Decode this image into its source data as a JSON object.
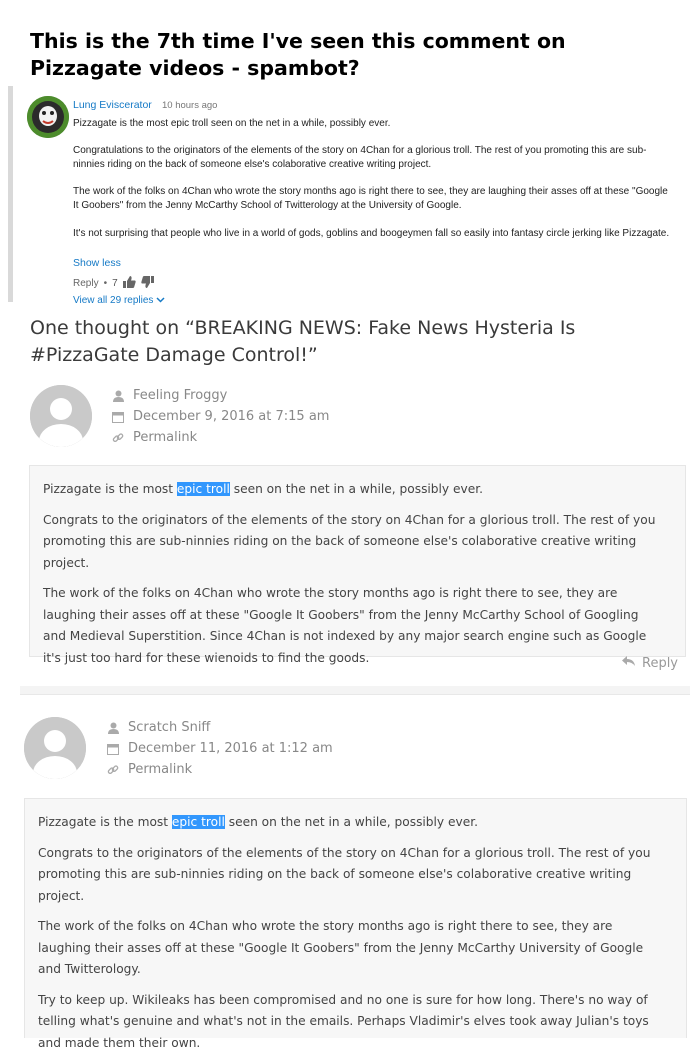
{
  "caption": "This is the 7th time I've seen this comment on Pizzagate videos - spambot?",
  "youtube": {
    "author": "Lung Eviscerator",
    "time": "10 hours ago",
    "paragraphs": [
      "Pizzagate is the most epic troll seen on the net in a while, possibly ever.",
      "Congratulations to the originators of the elements of the story on 4Chan for a glorious troll. The rest of you promoting this are sub-ninnies riding on the back of someone else's colaborative creative writing project.",
      "The work of the folks on 4Chan who wrote the story months ago is right there to see, they are laughing their asses off at these \"Google It Goobers\" from the Jenny McCarthy School of Twitterology at the University of Google.",
      "It's not surprising that people who live in a world of gods, goblins and boogeymen fall so easily into fantasy circle jerking like Pizzagate."
    ],
    "show_less": "Show less",
    "reply_label": "Reply",
    "dot": "•",
    "like_count": "7",
    "view_all": "View all 29 replies"
  },
  "blog": {
    "title": "One thought on “BREAKING NEWS: Fake News Hysteria Is #PizzaGate Damage Control!”",
    "comments": [
      {
        "author": "Feeling Froggy",
        "date": "December 9, 2016 at 7:15 am",
        "permalink": "Permalink",
        "p1_before": "Pizzagate is the most ",
        "p1_highlight": "epic troll",
        "p1_after": " seen on the net in a while, possibly ever.",
        "p2": "Congrats to the originators of the elements of the story on 4Chan for a glorious troll. The rest of you promoting this are sub-ninnies riding on the back of someone else's colaborative creative writing project.",
        "p3": "The work of the folks on 4Chan who wrote the story months ago is right there to see, they are laughing their asses off at these \"Google It Goobers\" from the Jenny McCarthy School of Googling and Medieval Superstition. Since 4Chan is not indexed by any major search engine such as Google it's just too hard for these wienoids to find the goods.",
        "reply": "Reply"
      },
      {
        "author": "Scratch Sniff",
        "date": "December 11, 2016 at 1:12 am",
        "permalink": "Permalink",
        "p1_before": "Pizzagate is the most ",
        "p1_highlight": "epic troll",
        "p1_after": " seen on the net in a while, possibly ever.",
        "p2": "Congrats to the originators of the elements of the story on 4Chan for a glorious troll. The rest of you promoting this are sub-ninnies riding on the back of someone else's colaborative creative writing project.",
        "p3": "The work of the folks on 4Chan who wrote the story months ago is right there to see, they are laughing their asses off at these \"Google It Goobers\" from the Jenny McCarthy University of Google and Twitterology.",
        "p4": "Try to keep up. Wikileaks has been compromised and no one is sure for how long. There's no way of telling what's genuine and what's not in the emails. Perhaps Vladimir's elves took away Julian's toys and made them their own."
      }
    ]
  },
  "colors": {
    "link_blue": "#167ac6",
    "highlight": "#3297fd",
    "box_bg": "#f7f7f7"
  },
  "icons": [
    "user-icon",
    "calendar-icon",
    "link-icon",
    "reply-icon",
    "thumbs-up-icon",
    "thumbs-down-icon",
    "chevron-down-icon"
  ]
}
